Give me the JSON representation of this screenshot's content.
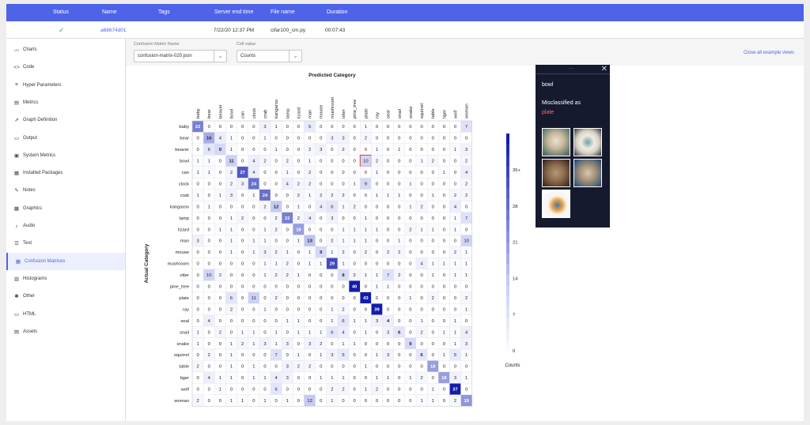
{
  "header": {
    "status": "Status",
    "name": "Name",
    "tags": "Tags",
    "server_end_time": "Server end time",
    "file_name": "File name",
    "duration": "Duration"
  },
  "experiment": {
    "status_icon": "✓",
    "name": "a88674d01",
    "server_end_time": "7/22/20 12:37 PM",
    "file_name": "cifar100_cm.py",
    "duration": "00:07:43"
  },
  "sidebar": {
    "items": [
      {
        "label": "Charts",
        "icon": "chart-line-icon",
        "glyph": "〰"
      },
      {
        "label": "Code",
        "icon": "code-icon",
        "glyph": "<>"
      },
      {
        "label": "Hyper Parameters",
        "icon": "list-icon",
        "glyph": "≡"
      },
      {
        "label": "Metrics",
        "icon": "table-icon",
        "glyph": "▤"
      },
      {
        "label": "Graph Definition",
        "icon": "graph-icon",
        "glyph": "⇗"
      },
      {
        "label": "Output",
        "icon": "monitor-icon",
        "glyph": "▭"
      },
      {
        "label": "System Metrics",
        "icon": "system-icon",
        "glyph": "▣"
      },
      {
        "label": "Installed Packages",
        "icon": "package-icon",
        "glyph": "▦"
      },
      {
        "label": "Notes",
        "icon": "pencil-icon",
        "glyph": "✎"
      },
      {
        "label": "Graphics",
        "icon": "image-icon",
        "glyph": "▩"
      },
      {
        "label": "Audio",
        "icon": "music-icon",
        "glyph": "♪"
      },
      {
        "label": "Text",
        "icon": "text-icon",
        "glyph": "☰"
      },
      {
        "label": "Confusion Matrices",
        "icon": "grid-icon",
        "glyph": "▦"
      },
      {
        "label": "Histograms",
        "icon": "histogram-icon",
        "glyph": "▥"
      },
      {
        "label": "Other",
        "icon": "puzzle-icon",
        "glyph": "✱"
      },
      {
        "label": "HTML",
        "icon": "html-icon",
        "glyph": "▭"
      },
      {
        "label": "Assets",
        "icon": "assets-icon",
        "glyph": "▤"
      }
    ],
    "active_index": 12
  },
  "controls": {
    "matrix_label": "Confusion Matrix Name",
    "matrix_value": "confusion-matrix-020.json",
    "cell_label": "Cell value",
    "cell_value": "Counts",
    "close_all": "Close all example views"
  },
  "popup": {
    "dots": "···",
    "close": "✕",
    "title": "bowl",
    "misclassified_as": "Misclassified as",
    "predicted": "plate"
  },
  "chart_data": {
    "type": "heatmap",
    "title": "Predicted Category",
    "xlabel": "Predicted Category",
    "ylabel": "Actual Category",
    "categories": [
      "baby",
      "bear",
      "beaver",
      "bowl",
      "can",
      "clock",
      "crab",
      "kangaroo",
      "lamp",
      "lizard",
      "man",
      "mouse",
      "mushroom",
      "otter",
      "pine_tree",
      "plate",
      "ray",
      "seal",
      "snail",
      "snake",
      "squirrel",
      "table",
      "tiger",
      "wolf",
      "woman"
    ],
    "values": [
      [
        22,
        0,
        0,
        0,
        0,
        0,
        3,
        1,
        0,
        0,
        5,
        0,
        0,
        0,
        0,
        1,
        0,
        0,
        0,
        0,
        0,
        0,
        0,
        0,
        7
      ],
      [
        0,
        16,
        4,
        1,
        0,
        0,
        1,
        0,
        0,
        0,
        0,
        0,
        3,
        3,
        0,
        2,
        0,
        0,
        0,
        0,
        0,
        0,
        0,
        0,
        0
      ],
      [
        0,
        6,
        9,
        1,
        0,
        0,
        0,
        1,
        0,
        0,
        2,
        3,
        0,
        2,
        0,
        0,
        1,
        0,
        1,
        0,
        0,
        0,
        0,
        1,
        3
      ],
      [
        1,
        1,
        0,
        11,
        0,
        4,
        2,
        0,
        2,
        0,
        1,
        0,
        0,
        0,
        0,
        10,
        2,
        0,
        0,
        0,
        1,
        2,
        0,
        0,
        2
      ],
      [
        1,
        1,
        0,
        2,
        27,
        4,
        0,
        0,
        1,
        0,
        2,
        0,
        0,
        0,
        0,
        0,
        1,
        0,
        0,
        0,
        0,
        0,
        1,
        0,
        4
      ],
      [
        0,
        0,
        0,
        2,
        3,
        24,
        0,
        0,
        4,
        2,
        2,
        0,
        0,
        0,
        1,
        9,
        0,
        0,
        0,
        1,
        0,
        0,
        0,
        0,
        2
      ],
      [
        1,
        0,
        1,
        3,
        0,
        1,
        24,
        0,
        0,
        2,
        1,
        2,
        2,
        2,
        0,
        0,
        1,
        1,
        1,
        0,
        0,
        1,
        0,
        2,
        2
      ],
      [
        0,
        1,
        0,
        0,
        0,
        0,
        2,
        12,
        0,
        1,
        0,
        4,
        6,
        1,
        2,
        0,
        0,
        0,
        0,
        1,
        2,
        0,
        0,
        4,
        0
      ],
      [
        0,
        0,
        0,
        1,
        2,
        0,
        0,
        2,
        22,
        2,
        4,
        0,
        3,
        0,
        0,
        1,
        0,
        0,
        0,
        0,
        0,
        0,
        0,
        1,
        7
      ],
      [
        0,
        0,
        1,
        1,
        0,
        0,
        1,
        2,
        0,
        18,
        0,
        0,
        0,
        1,
        1,
        1,
        1,
        0,
        0,
        2,
        1,
        1,
        0,
        1,
        0
      ],
      [
        3,
        0,
        0,
        1,
        0,
        1,
        1,
        0,
        0,
        1,
        13,
        0,
        2,
        1,
        1,
        1,
        0,
        0,
        1,
        0,
        0,
        0,
        0,
        0,
        10
      ],
      [
        0,
        0,
        0,
        1,
        0,
        1,
        3,
        2,
        1,
        0,
        1,
        9,
        1,
        2,
        0,
        2,
        0,
        2,
        2,
        0,
        0,
        0,
        0,
        2,
        1
      ],
      [
        0,
        0,
        0,
        0,
        0,
        0,
        1,
        1,
        2,
        0,
        1,
        1,
        29,
        1,
        0,
        0,
        0,
        0,
        0,
        0,
        4,
        1,
        1,
        1,
        1
      ],
      [
        0,
        10,
        2,
        0,
        0,
        0,
        1,
        2,
        2,
        1,
        0,
        0,
        0,
        8,
        2,
        1,
        1,
        7,
        2,
        0,
        0,
        1,
        0,
        1,
        1
      ],
      [
        0,
        0,
        0,
        0,
        0,
        0,
        0,
        0,
        0,
        0,
        0,
        0,
        0,
        0,
        40,
        0,
        1,
        1,
        0,
        0,
        0,
        0,
        0,
        0,
        0
      ],
      [
        0,
        0,
        0,
        6,
        0,
        11,
        0,
        2,
        0,
        0,
        0,
        0,
        0,
        0,
        0,
        43,
        0,
        0,
        0,
        1,
        0,
        2,
        0,
        0,
        2
      ],
      [
        0,
        0,
        0,
        2,
        0,
        0,
        1,
        0,
        0,
        0,
        0,
        0,
        1,
        2,
        0,
        0,
        39,
        0,
        0,
        0,
        0,
        0,
        0,
        0,
        1
      ],
      [
        0,
        4,
        0,
        0,
        0,
        0,
        0,
        0,
        1,
        1,
        0,
        0,
        1,
        6,
        1,
        1,
        3,
        4,
        0,
        0,
        1,
        0,
        0,
        1,
        0
      ],
      [
        1,
        0,
        2,
        0,
        1,
        1,
        0,
        1,
        0,
        1,
        1,
        1,
        6,
        4,
        0,
        1,
        0,
        3,
        6,
        0,
        2,
        0,
        1,
        1,
        4
      ],
      [
        1,
        0,
        0,
        1,
        2,
        1,
        3,
        1,
        3,
        0,
        3,
        2,
        0,
        1,
        1,
        0,
        0,
        0,
        0,
        9,
        0,
        0,
        0,
        1,
        3
      ],
      [
        0,
        2,
        0,
        1,
        0,
        0,
        0,
        7,
        0,
        1,
        0,
        1,
        3,
        5,
        0,
        0,
        1,
        3,
        0,
        0,
        6,
        0,
        1,
        5,
        1
      ],
      [
        2,
        0,
        0,
        1,
        0,
        1,
        0,
        0,
        3,
        2,
        2,
        0,
        0,
        0,
        0,
        1,
        0,
        0,
        0,
        0,
        0,
        18,
        0,
        0,
        0
      ],
      [
        0,
        4,
        1,
        1,
        0,
        1,
        1,
        4,
        3,
        0,
        0,
        1,
        1,
        1,
        0,
        0,
        1,
        1,
        0,
        1,
        2,
        0,
        18,
        3,
        1
      ],
      [
        0,
        0,
        1,
        0,
        0,
        0,
        0,
        6,
        0,
        0,
        0,
        0,
        2,
        2,
        0,
        1,
        2,
        0,
        0,
        0,
        0,
        1,
        0,
        37,
        0
      ],
      [
        2,
        0,
        0,
        1,
        1,
        0,
        1,
        0,
        1,
        0,
        12,
        0,
        1,
        0,
        0,
        0,
        0,
        0,
        0,
        0,
        1,
        1,
        0,
        2,
        19
      ]
    ],
    "selected_cell": {
      "actual": "bowl",
      "predicted": "plate",
      "value": 10
    },
    "colorbar": {
      "label": "Counts",
      "ticks": [
        "0",
        "7",
        "14",
        "21",
        "28",
        "35+"
      ],
      "min": 0,
      "max": 35
    }
  }
}
